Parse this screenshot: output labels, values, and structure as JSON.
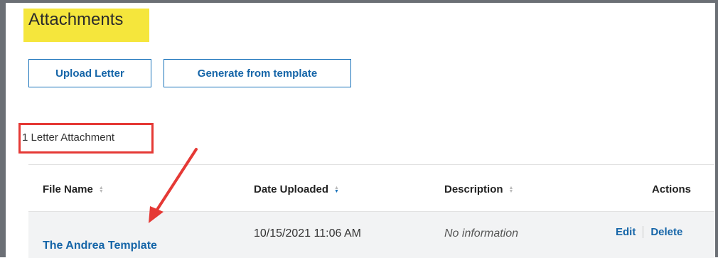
{
  "section": {
    "title": "Attachments"
  },
  "buttons": {
    "upload": "Upload Letter",
    "generate": "Generate from template"
  },
  "attachment_count": "1 Letter Attachment",
  "table": {
    "columns": [
      {
        "label": "File Name",
        "sort": "none"
      },
      {
        "label": "Date Uploaded",
        "sort": "descending"
      },
      {
        "label": "Description",
        "sort": "none"
      },
      {
        "label": "Actions"
      }
    ],
    "rows": [
      {
        "file_name": "The Andrea Template",
        "date_uploaded": "10/15/2021 11:06 AM",
        "description": "No information",
        "actions": [
          "Edit",
          "Delete"
        ]
      }
    ]
  },
  "annotations": {
    "highlight_color": "#f5e63c",
    "box_color": "#e53935",
    "arrow_color": "#e53935"
  },
  "colors": {
    "link": "#1565a8",
    "button_border": "#1a73bb",
    "frame": "#6b6f75"
  }
}
